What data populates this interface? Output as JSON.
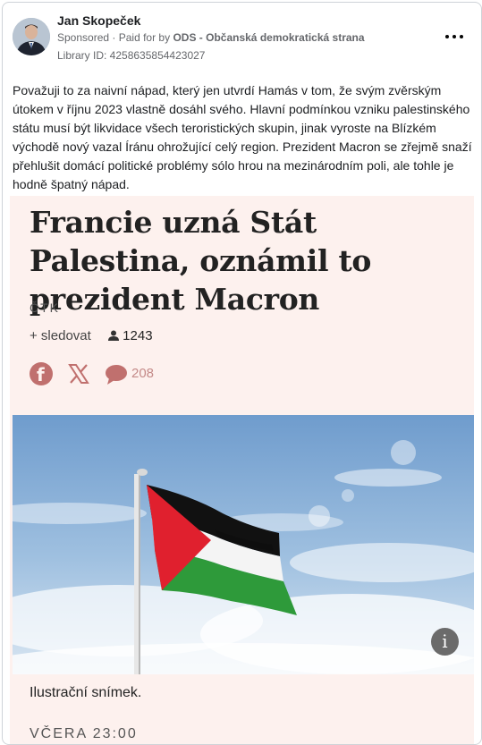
{
  "post": {
    "author": "Jan Skopeček",
    "sponsored": "Sponsored",
    "paid_for_prefix": "Paid for by",
    "payer": "ODS - Občanská demokratická strana",
    "library_id": "Library ID: 4258635854423027",
    "more_icon": "more-options-icon",
    "text": "Považuji to za naivní nápad, který jen utvrdí Hamás v tom, že svým zvěrským útokem v říjnu 2023 vlastně dosáhl svého. Hlavní podmínkou vzniku palestinského státu musí být likvidace všech teroristických skupin, jinak vyroste na Blízkém východě nový vazal Íránu ohrožující celý region. Prezident Macron se zřejmě snaží přehlušit domácí politické problémy sólo hrou na mezinárodním poli, ale tohle je hodně špatný nápad."
  },
  "article": {
    "headline": "Francie uzná Stát Palestina, oznámil to prezident Macron",
    "source": "ČTK",
    "follow_label": "+ sledovat",
    "followers": "1243",
    "comment_count": "208",
    "caption": "Ilustrační snímek.",
    "date_partial": "VČERA 23:00",
    "colors": {
      "background": "#fdf1ee",
      "flag_red": "#e0202e",
      "flag_black": "#111111",
      "flag_green": "#2e9a3a",
      "social_icon": "#c0706e"
    }
  }
}
